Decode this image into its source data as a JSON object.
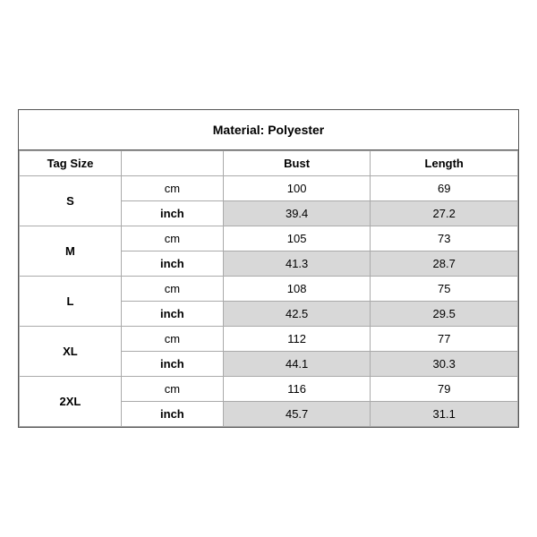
{
  "title": "Material: Polyester",
  "headers": {
    "tag_size": "Tag Size",
    "bust": "Bust",
    "length": "Length"
  },
  "sizes": [
    {
      "tag": "S",
      "cm": {
        "bust": "100",
        "length": "69"
      },
      "inch": {
        "bust": "39.4",
        "length": "27.2"
      }
    },
    {
      "tag": "M",
      "cm": {
        "bust": "105",
        "length": "73"
      },
      "inch": {
        "bust": "41.3",
        "length": "28.7"
      }
    },
    {
      "tag": "L",
      "cm": {
        "bust": "108",
        "length": "75"
      },
      "inch": {
        "bust": "42.5",
        "length": "29.5"
      }
    },
    {
      "tag": "XL",
      "cm": {
        "bust": "112",
        "length": "77"
      },
      "inch": {
        "bust": "44.1",
        "length": "30.3"
      }
    },
    {
      "tag": "2XL",
      "cm": {
        "bust": "116",
        "length": "79"
      },
      "inch": {
        "bust": "45.7",
        "length": "31.1"
      }
    }
  ],
  "unit_labels": {
    "cm": "cm",
    "inch": "inch"
  }
}
